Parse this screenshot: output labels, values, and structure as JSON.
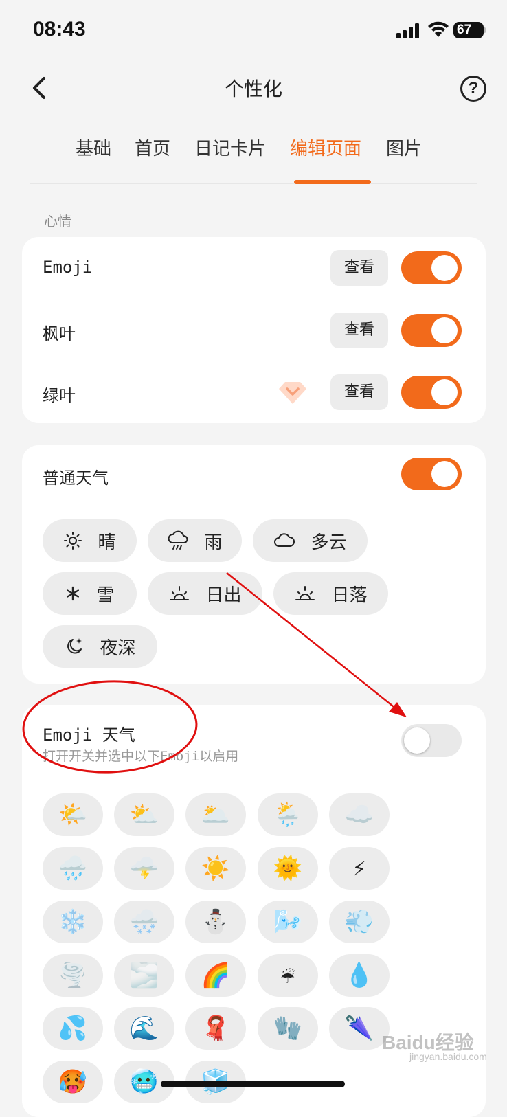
{
  "status_bar": {
    "time": "08:43",
    "battery": "67"
  },
  "header": {
    "title": "个性化",
    "help": "?"
  },
  "tabs": [
    {
      "label": "基础",
      "active": false
    },
    {
      "label": "首页",
      "active": false
    },
    {
      "label": "日记卡片",
      "active": false
    },
    {
      "label": "编辑页面",
      "active": true
    },
    {
      "label": "图片",
      "active": false
    }
  ],
  "accent_color": "#f26a1b",
  "mood": {
    "section_label": "心情",
    "items": [
      {
        "label": "Emoji",
        "view_label": "查看",
        "enabled": true,
        "premium": false
      },
      {
        "label": "枫叶",
        "view_label": "查看",
        "enabled": true,
        "premium": false
      },
      {
        "label": "绿叶",
        "view_label": "查看",
        "enabled": true,
        "premium": true
      }
    ]
  },
  "normal_weather": {
    "label": "普通天气",
    "enabled": true,
    "chips": [
      {
        "label": "晴",
        "icon": "sun-icon"
      },
      {
        "label": "雨",
        "icon": "rain-cloud-icon"
      },
      {
        "label": "多云",
        "icon": "cloud-icon"
      },
      {
        "label": "雪",
        "icon": "snowflake-icon"
      },
      {
        "label": "日出",
        "icon": "sunrise-icon"
      },
      {
        "label": "日落",
        "icon": "sunset-icon"
      },
      {
        "label": "夜深",
        "icon": "moon-star-icon"
      }
    ]
  },
  "emoji_weather": {
    "label": "Emoji 天气",
    "hint": "打开开关并选中以下Emoji以启用",
    "enabled": false,
    "emojis": [
      "🌤️",
      "⛅",
      "🌥️",
      "🌦️",
      "☁️",
      "🌧️",
      "🌩️",
      "☀️",
      "🌞",
      "⚡",
      "❄️",
      "🌨️",
      "⛄",
      "🌬️",
      "💨",
      "🌪️",
      "🌫️",
      "🌈",
      "☔",
      "💧",
      "💦",
      "🌊",
      "🧣",
      "🧤",
      "🌂",
      "🥵",
      "🥶",
      "🧊"
    ]
  },
  "watermark": {
    "brand": "Baidu经验",
    "url": "jingyan.baidu.com"
  }
}
